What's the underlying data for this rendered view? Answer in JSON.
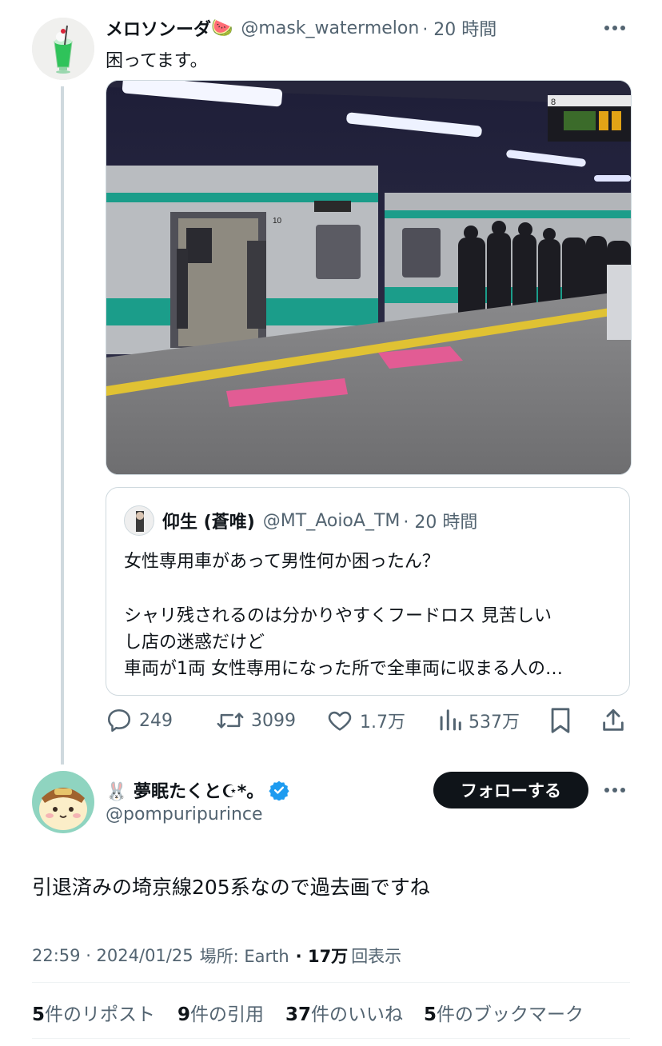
{
  "tweet1": {
    "display_name": "メロソンーダ",
    "emoji": "🍉",
    "handle": "@mask_watermelon",
    "time": "· 20 時間",
    "text": "困ってます。"
  },
  "quote": {
    "display_name": "仰生 (蒼唯)",
    "handle": "@MT_AoioA_TM",
    "time": "· 20 時間",
    "line1": "女性専用車があって男性何か困ったん？",
    "line2": "シャリ残されるのは分かりやすくフードロス 見苦しい",
    "line3": "し店の迷惑だけど",
    "line4": "車両が1両 女性専用になった所で全車両に収まる人の…"
  },
  "actions": {
    "replies": "249",
    "retweets": "3099",
    "likes": "1.7万",
    "views": "537万"
  },
  "tweet2": {
    "display_name": "🐰 夢眠たくと☪*。",
    "handle": "@pompuripurince",
    "follow_label": "フォローする",
    "text": "引退済みの埼京線205系なので過去画ですね",
    "timestamp": "22:59 · 2024/01/25",
    "location_label": "場所: Earth",
    "views_count": "· 17万",
    "views_label": "回表示"
  },
  "stats": {
    "reposts_count": "5",
    "reposts_label": "件のリポスト",
    "quotes_count": "9",
    "quotes_label": "件の引用",
    "likes_count": "37",
    "likes_label": "件のいいね",
    "bookmarks_count": "5",
    "bookmarks_label": "件のブックマーク"
  },
  "photo_signs": {
    "car_number": "10",
    "platform_number": "8"
  },
  "colors": {
    "accent_blue": "#1d9bf0",
    "text_primary": "#0f1419",
    "text_secondary": "#536471",
    "border": "#cfd9de",
    "train_green": "#1b9d8a",
    "women_only_pink": "#e25c94"
  },
  "icons": {
    "reply": "speech-bubble-icon",
    "retweet": "retweet-icon",
    "like": "heart-icon",
    "views": "bar-chart-icon",
    "bookmark": "bookmark-icon",
    "share": "share-icon",
    "verified": "verified-badge-icon",
    "more": "more-icon"
  }
}
